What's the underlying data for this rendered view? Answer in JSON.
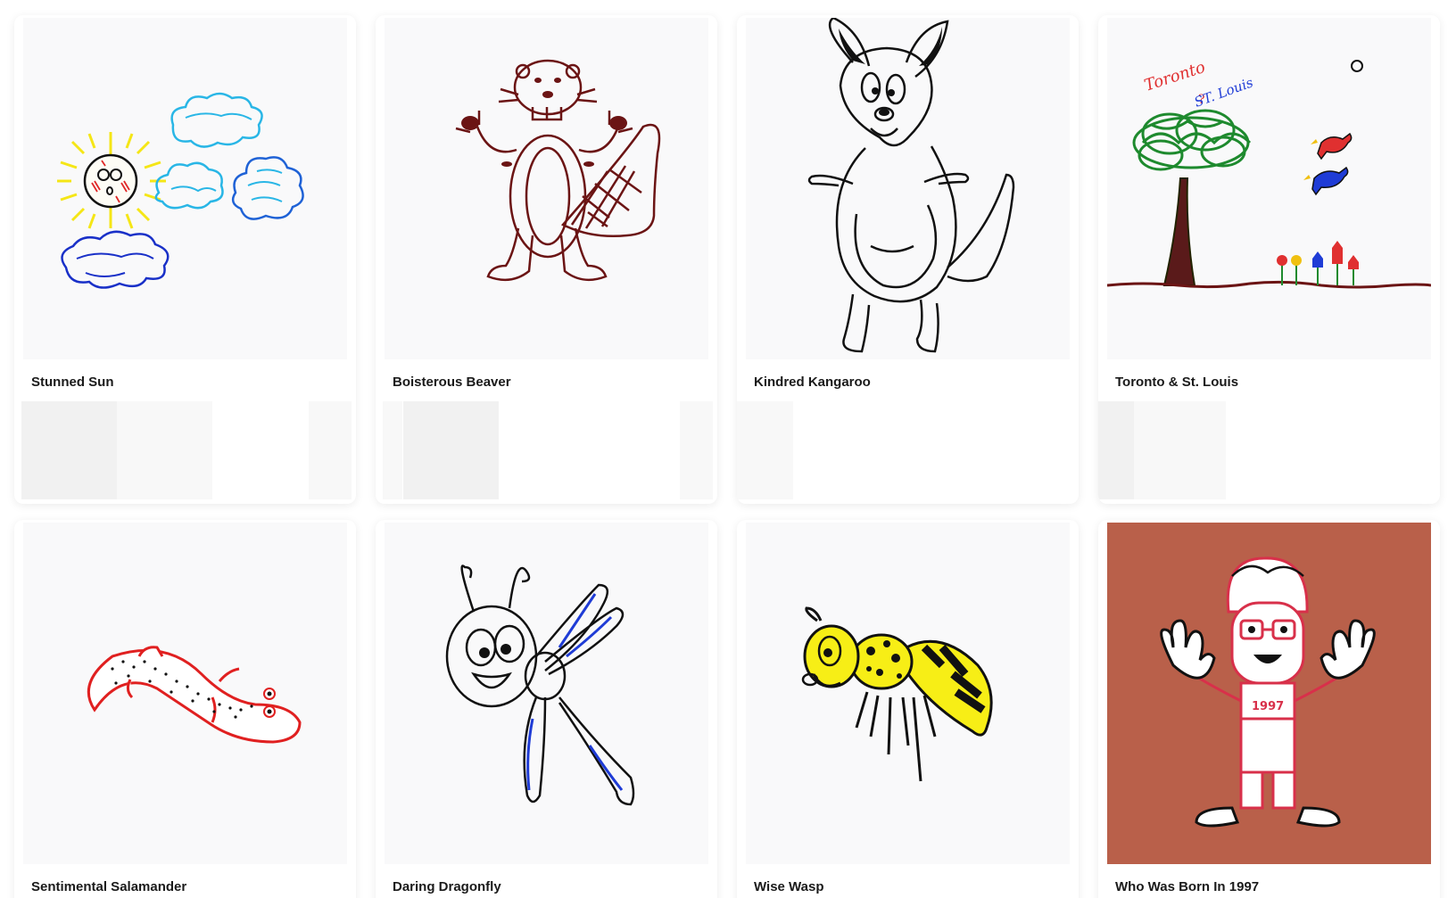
{
  "gallery": {
    "items": [
      {
        "title": "Stunned Sun",
        "icon": "sun-drawing-icon"
      },
      {
        "title": "Boisterous Beaver",
        "icon": "beaver-drawing-icon"
      },
      {
        "title": "Kindred Kangaroo",
        "icon": "kangaroo-drawing-icon"
      },
      {
        "title": "Toronto & St. Louis",
        "icon": "tree-birds-drawing-icon",
        "drawn_text": [
          "Toronto",
          "?",
          "ST. Louis"
        ]
      },
      {
        "title": "Sentimental Salamander",
        "icon": "salamander-drawing-icon"
      },
      {
        "title": "Daring Dragonfly",
        "icon": "dragonfly-drawing-icon"
      },
      {
        "title": "Wise Wasp",
        "icon": "wasp-drawing-icon"
      },
      {
        "title": "Who Was Born In 1997",
        "icon": "boy-drawing-icon",
        "drawn_text": [
          "1997"
        ]
      }
    ]
  },
  "colors": {
    "card_background": "#ffffff",
    "thumb_background": "#f9f9fa",
    "placeholder_gray": "#f1f1f1",
    "placeholder_light": "#f8f8f8",
    "boy_background": "#b9604a",
    "title_text": "#1a1a1a"
  }
}
